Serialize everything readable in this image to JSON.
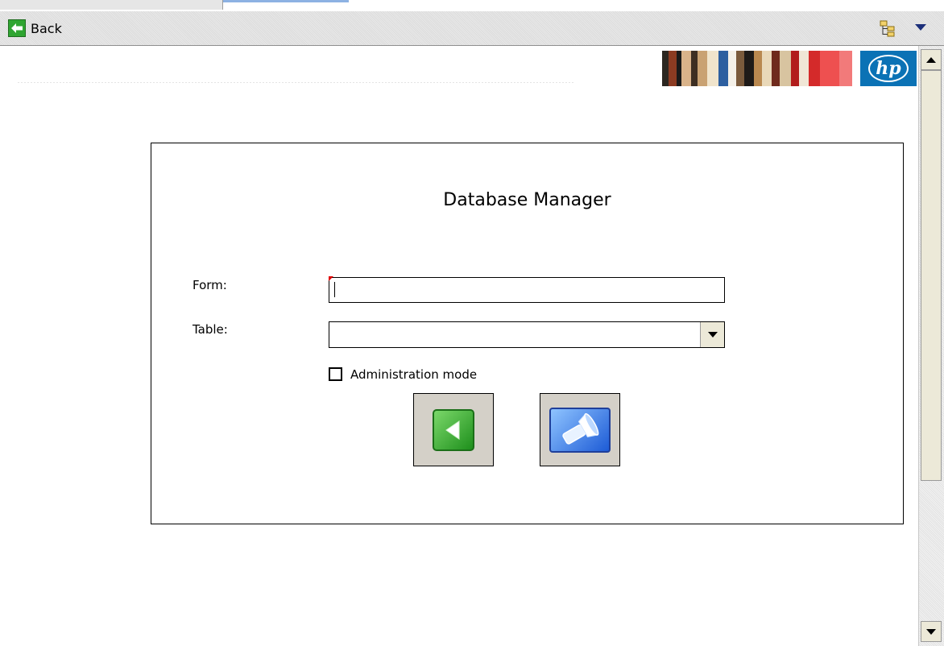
{
  "toolbar": {
    "back_label": "Back",
    "back_icon": "back-arrow-icon",
    "tree_icon": "folder-tree-icon",
    "menu_icon": "chevron-down-icon"
  },
  "banner": {
    "logo_text": "hp",
    "logo_color": "#0b72b5"
  },
  "form": {
    "title": "Database Manager",
    "form_label": "Form:",
    "form_value": "",
    "table_label": "Table:",
    "table_value": "",
    "admin_mode_label": "Administration mode",
    "admin_mode_checked": false,
    "back_button_icon": "green-back-arrow-icon",
    "search_button_icon": "flashlight-search-icon"
  },
  "colors": {
    "back_green": "#2fa531",
    "search_blue": "#1d5bd6",
    "required_marker": "#e00000"
  }
}
